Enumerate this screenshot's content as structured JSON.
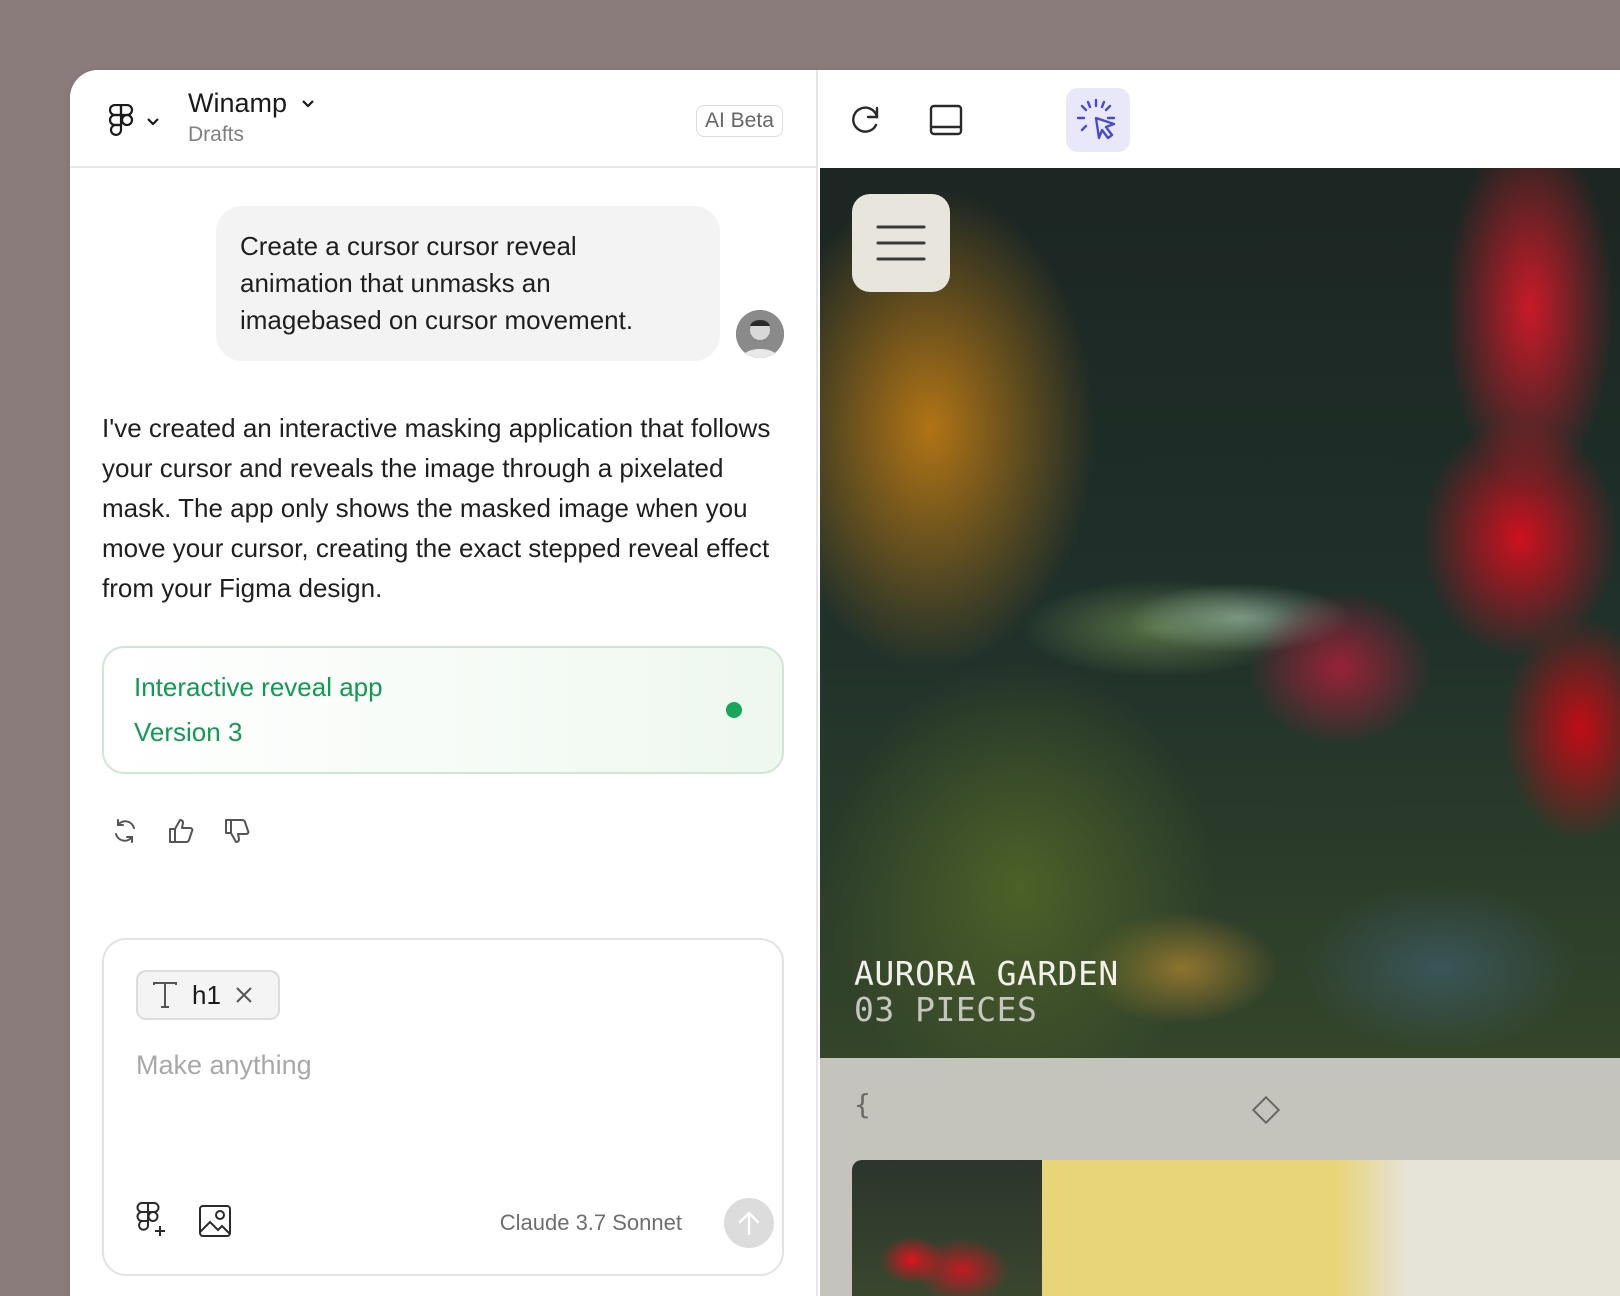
{
  "header": {
    "project_title": "Winamp",
    "project_subtitle": "Drafts",
    "badge": "AI Beta"
  },
  "chat": {
    "user_message": "Create a cursor cursor reveal animation that unmasks an imagebased on cursor movement.",
    "ai_message": "I've created an interactive masking application that follows your cursor and reveals the image through a pixelated mask. The app only shows the masked image when you move your cursor, creating the exact stepped reveal effect from your Figma design.",
    "artifact_card": {
      "title": "Interactive reveal app",
      "version": "Version 3",
      "status_color": "#17a65a"
    },
    "actions": [
      "refresh-icon",
      "thumbs-up-icon",
      "thumbs-down-icon"
    ]
  },
  "composer": {
    "chip_label": "h1",
    "placeholder": "Make anything",
    "model_name": "Claude 3.7 Sonnet"
  },
  "preview": {
    "toolbar_icons": [
      "reload-icon",
      "layout-panel-icon",
      "cursor-spark-icon"
    ],
    "hero_title": "AURORA GARDEN",
    "hero_subtitle": "03 PIECES",
    "lower_brace": "{",
    "accent_color": "#5a5ad6",
    "active_tool_bg": "#e9e8fb"
  }
}
